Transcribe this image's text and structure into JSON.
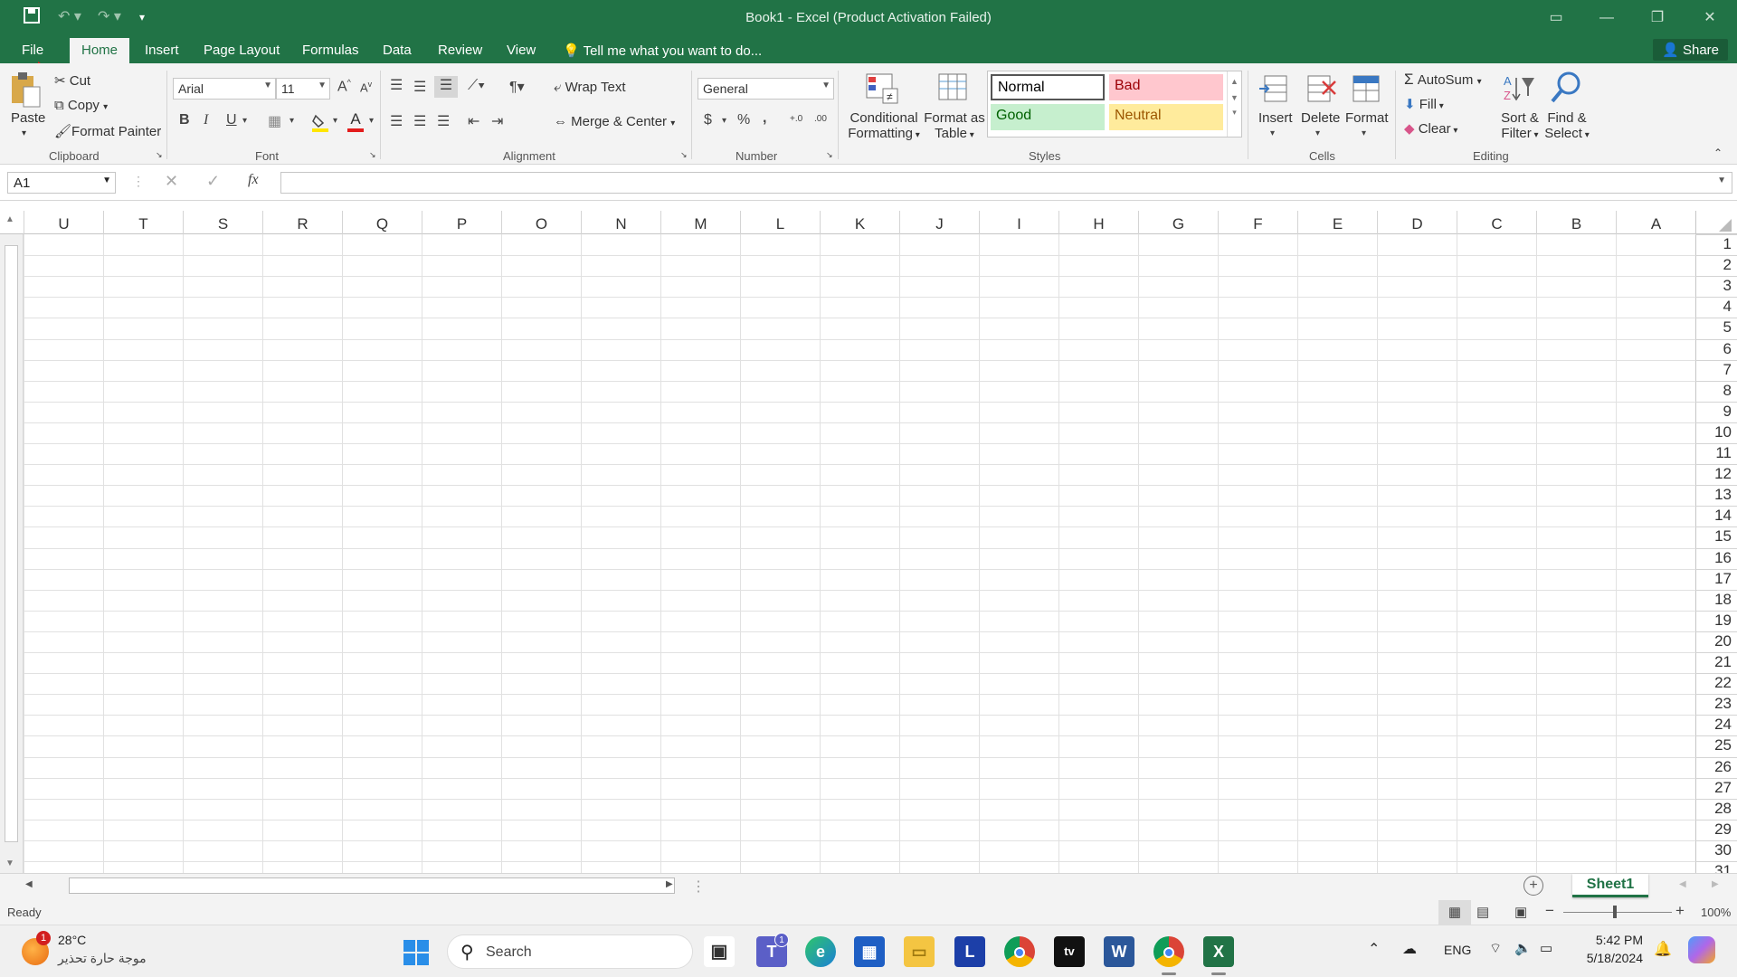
{
  "window": {
    "title": "Book1 - Excel (Product Activation Failed)"
  },
  "tabs": [
    {
      "label": "File"
    },
    {
      "label": "Home"
    },
    {
      "label": "Insert"
    },
    {
      "label": "Page Layout"
    },
    {
      "label": "Formulas"
    },
    {
      "label": "Data"
    },
    {
      "label": "Review"
    },
    {
      "label": "View"
    }
  ],
  "tell_me": "Tell me what you want to do...",
  "share_label": "Share",
  "clipboard": {
    "paste": "Paste",
    "cut": "Cut",
    "copy": "Copy",
    "format_painter": "Format Painter",
    "group": "Clipboard"
  },
  "font": {
    "name": "Arial",
    "size": "11",
    "bold": "B",
    "italic": "I",
    "underline": "U",
    "color_glyph": "A",
    "grow": "A",
    "shrink": "A",
    "group": "Font"
  },
  "alignment": {
    "wrap": "Wrap Text",
    "merge": "Merge & Center",
    "group": "Alignment"
  },
  "number": {
    "format": "General",
    "currency": "$",
    "percent": "%",
    "comma": ",",
    "inc": "+.0",
    "dec": ".00",
    "group": "Number"
  },
  "styles": {
    "conditional": [
      "Conditional",
      "Formatting"
    ],
    "format_table": [
      "Format as",
      "Table"
    ],
    "normal": "Normal",
    "bad": "Bad",
    "good": "Good",
    "neutral": "Neutral",
    "group": "Styles"
  },
  "cells": {
    "insert": "Insert",
    "delete": "Delete",
    "format": "Format",
    "group": "Cells"
  },
  "editing": {
    "autosum": "AutoSum",
    "fill": "Fill",
    "clear": "Clear",
    "sort": [
      "Sort &",
      "Filter"
    ],
    "find": [
      "Find &",
      "Select"
    ],
    "group": "Editing"
  },
  "name_box": "A1",
  "fx": "fx",
  "columns": [
    "U",
    "T",
    "S",
    "R",
    "Q",
    "P",
    "O",
    "N",
    "M",
    "L",
    "K",
    "J",
    "I",
    "H",
    "G",
    "F",
    "E",
    "D",
    "C",
    "B",
    "A"
  ],
  "rows": [
    "1",
    "2",
    "3",
    "4",
    "5",
    "6",
    "7",
    "8",
    "9",
    "10",
    "11",
    "12",
    "13",
    "14",
    "15",
    "16",
    "17",
    "18",
    "19",
    "20",
    "21",
    "22",
    "23",
    "24",
    "25",
    "26",
    "27",
    "28",
    "29",
    "30",
    "31"
  ],
  "sheet_tab": "Sheet1",
  "status": {
    "ready": "Ready",
    "zoom": "100%"
  },
  "taskbar": {
    "weather_temp": "28°C",
    "weather_desc": "موجة حارة تحذير",
    "weather_badge": "1",
    "search": "Search",
    "teams_badge": "1",
    "lang": "ENG",
    "time": "5:42 PM",
    "date": "5/18/2024",
    "apps": [
      "L",
      "tv",
      "W",
      "X"
    ]
  }
}
